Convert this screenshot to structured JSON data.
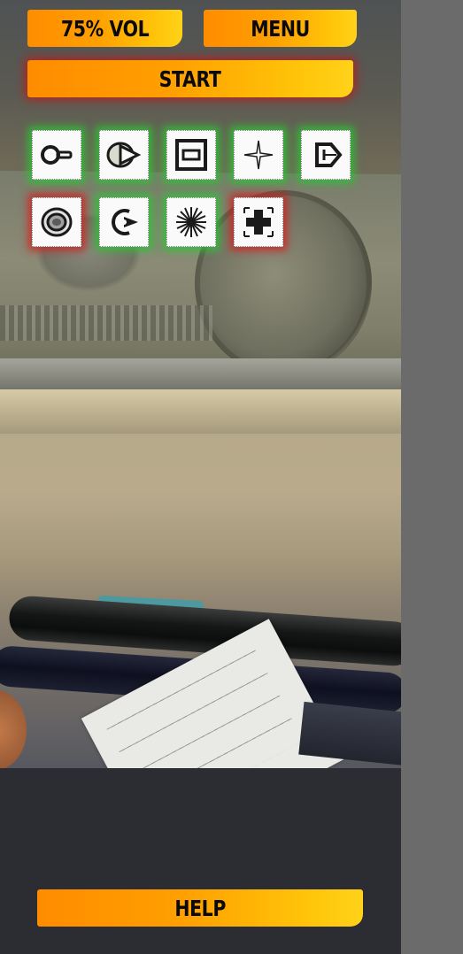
{
  "toolbar": {
    "volume_label": "75% VOL",
    "menu_label": "MENU",
    "start_label": "START"
  },
  "tools": [
    {
      "icon": "key-icon",
      "glow": "green"
    },
    {
      "icon": "eye-lens-icon",
      "glow": "green"
    },
    {
      "icon": "h-beam-icon",
      "glow": "green"
    },
    {
      "icon": "sparkle-icon",
      "glow": "green"
    },
    {
      "icon": "arrowhead-icon",
      "glow": "green"
    },
    {
      "icon": "concentric-rings-icon",
      "glow": "red"
    },
    {
      "icon": "camera-lens-icon",
      "glow": "green"
    },
    {
      "icon": "starburst-icon",
      "glow": "green"
    },
    {
      "icon": "cross-target-icon",
      "glow": "red"
    }
  ],
  "footer": {
    "help_label": "HELP"
  },
  "colors": {
    "button_gradient_start": "#ff8c00",
    "button_gradient_end": "#ffd21a",
    "glow_green": "#28c832",
    "glow_red": "#d21e1e",
    "panel_bg": "#2c2d33",
    "side_bg": "#6b6b6b"
  }
}
